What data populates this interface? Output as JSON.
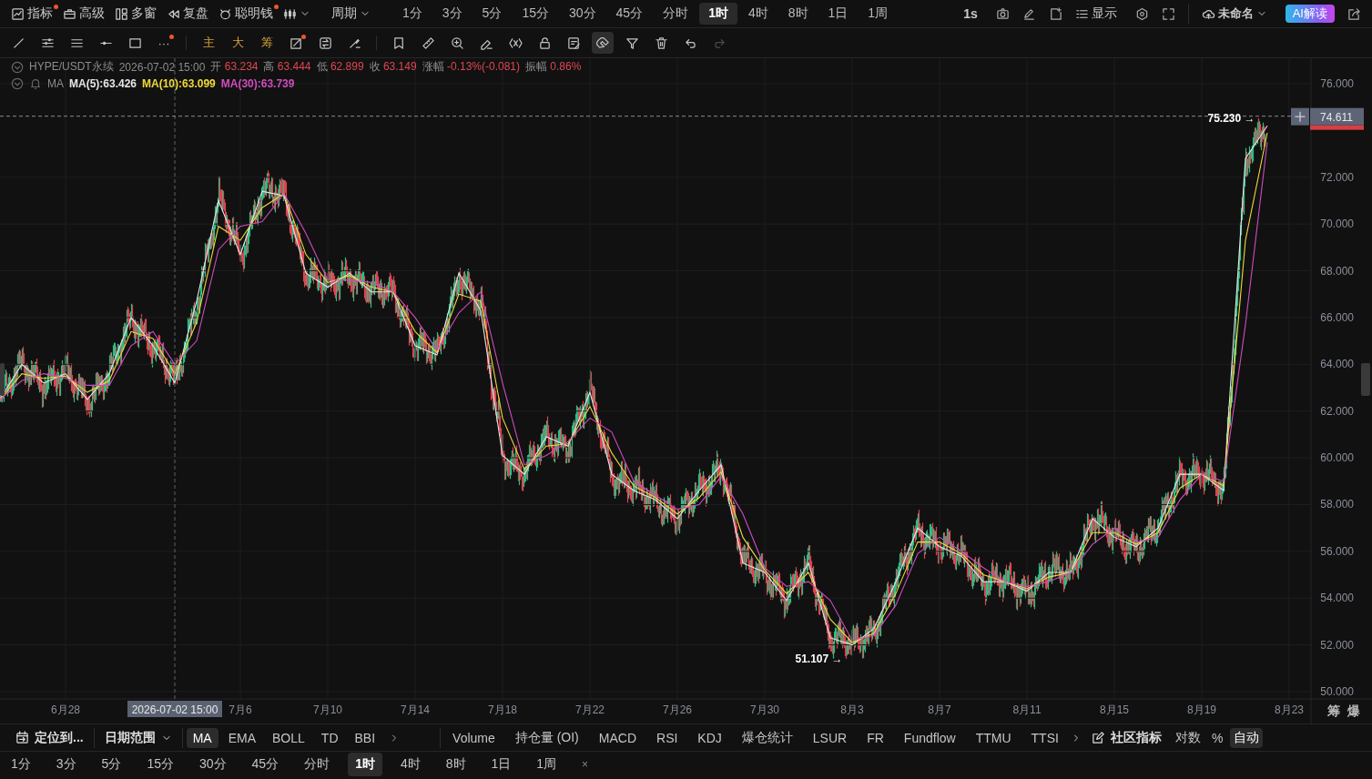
{
  "top_bar": {
    "menus": [
      {
        "label": "指标",
        "dot": true
      },
      {
        "label": "高级",
        "dot": false
      },
      {
        "label": "多窗",
        "dot": false
      },
      {
        "label": "复盘",
        "dot": false
      },
      {
        "label": "聪明钱",
        "dot": true
      }
    ],
    "period_menu": "周期",
    "periods": [
      {
        "label": "1分",
        "selected": false
      },
      {
        "label": "3分",
        "selected": false
      },
      {
        "label": "5分",
        "selected": false
      },
      {
        "label": "15分",
        "selected": false
      },
      {
        "label": "30分",
        "selected": false
      },
      {
        "label": "45分",
        "selected": false
      },
      {
        "label": "分时",
        "selected": false
      },
      {
        "label": "1时",
        "selected": true
      },
      {
        "label": "4时",
        "selected": false
      },
      {
        "label": "8时",
        "selected": false
      },
      {
        "label": "1日",
        "selected": false
      },
      {
        "label": "1周",
        "selected": false
      }
    ],
    "refresh": "1s",
    "display": "显示",
    "layout_name": "未命名",
    "ai_button": "AI解读"
  },
  "draw_toolbar": {
    "groups": [
      {
        "tools": [
          {
            "kind": "icon",
            "dot": false,
            "selected": false,
            "disabled": false
          },
          {
            "kind": "icon",
            "dot": false,
            "selected": false,
            "disabled": false
          },
          {
            "kind": "icon",
            "dot": false,
            "selected": false,
            "disabled": false
          },
          {
            "kind": "icon",
            "dot": false,
            "selected": false,
            "disabled": false
          },
          {
            "kind": "icon",
            "dot": false,
            "selected": false,
            "disabled": false
          },
          {
            "kind": "text",
            "label": "···",
            "dot": true,
            "selected": false,
            "disabled": false
          }
        ]
      },
      {
        "tools": [
          {
            "kind": "text",
            "label": "主",
            "dot": false,
            "selected": false,
            "disabled": false
          },
          {
            "kind": "text",
            "label": "大",
            "dot": false,
            "selected": false,
            "disabled": false
          },
          {
            "kind": "text",
            "label": "筹",
            "dot": false,
            "selected": false,
            "disabled": false
          },
          {
            "kind": "icon",
            "dot": true,
            "selected": false,
            "disabled": false
          },
          {
            "kind": "icon",
            "dot": false,
            "selected": false,
            "disabled": false
          },
          {
            "kind": "icon",
            "dot": false,
            "selected": false,
            "disabled": false
          }
        ]
      },
      {
        "tools": [
          {
            "kind": "icon",
            "dot": false,
            "selected": false,
            "disabled": false
          },
          {
            "kind": "icon",
            "dot": false,
            "selected": false,
            "disabled": false
          },
          {
            "kind": "icon",
            "dot": false,
            "selected": false,
            "disabled": false
          },
          {
            "kind": "icon",
            "dot": false,
            "selected": false,
            "disabled": false
          },
          {
            "kind": "icon",
            "dot": false,
            "selected": false,
            "disabled": false
          },
          {
            "kind": "icon",
            "dot": false,
            "selected": false,
            "disabled": false
          },
          {
            "kind": "icon",
            "dot": false,
            "selected": false,
            "disabled": false
          },
          {
            "kind": "icon",
            "dot": false,
            "selected": true,
            "disabled": false
          },
          {
            "kind": "icon",
            "dot": false,
            "selected": false,
            "disabled": false
          },
          {
            "kind": "icon",
            "dot": false,
            "selected": false,
            "disabled": false
          },
          {
            "kind": "icon",
            "dot": false,
            "selected": false,
            "disabled": false
          },
          {
            "kind": "icon",
            "dot": false,
            "selected": false,
            "disabled": true
          }
        ]
      }
    ]
  },
  "legend": {
    "symbol": "HYPE/USDT永续",
    "time": "2026-07-02 15:00",
    "stats": [
      {
        "label": "开",
        "value": "63.234"
      },
      {
        "label": "高",
        "value": "63.444"
      },
      {
        "label": "低",
        "value": "62.899"
      },
      {
        "label": "收",
        "value": "63.149"
      },
      {
        "label": "涨幅",
        "value": "-0.13%(-0.081)"
      },
      {
        "label": "振幅",
        "value": "0.86%"
      }
    ],
    "ma_label": "MA",
    "ma_readings": [
      ":63.426",
      ":63.099",
      ":63.739"
    ]
  },
  "chart_data": {
    "type": "line",
    "grid": true,
    "categories": [
      null,
      null,
      null,
      "6月28",
      null,
      null,
      null,
      null,
      null,
      null,
      null,
      "7月6",
      null,
      null,
      null,
      "7月10",
      null,
      null,
      null,
      "7月14",
      null,
      null,
      null,
      "7月18",
      null,
      null,
      null,
      "7月22",
      null,
      null,
      null,
      "7月26",
      null,
      null,
      null,
      "7月30",
      null,
      null,
      null,
      "8月3",
      null,
      null,
      null,
      "8月7",
      null,
      null,
      null,
      "8月11",
      null,
      null,
      null,
      "8月15",
      null,
      null,
      null,
      "8月19",
      null,
      null,
      null,
      "8月23"
    ],
    "ylim": [
      50,
      76
    ],
    "yticks": [
      {
        "value": 50,
        "label": "50.000"
      },
      {
        "value": 52,
        "label": "52.000"
      },
      {
        "value": 54,
        "label": "54.000"
      },
      {
        "value": 56,
        "label": "56.000"
      },
      {
        "value": 58,
        "label": "58.000"
      },
      {
        "value": 60,
        "label": "60.000"
      },
      {
        "value": 62,
        "label": "62.000"
      },
      {
        "value": 64,
        "label": "64.000"
      },
      {
        "value": 66,
        "label": "66.000"
      },
      {
        "value": 68,
        "label": "68.000"
      },
      {
        "value": 70,
        "label": "70.000"
      },
      {
        "value": 72,
        "label": "72.000"
      },
      {
        "value": 76,
        "label": "76.000"
      }
    ],
    "series": [
      {
        "name": "MA(5)",
        "color": "#e6e6e6",
        "values": [
          62.5,
          64,
          63.2,
          63.6,
          62.5,
          63.6,
          66,
          64.8,
          63.2,
          66.7,
          71,
          68.7,
          71.4,
          71.2,
          67.9,
          67.3,
          67.9,
          67.1,
          67.1,
          64.8,
          64.4,
          67.9,
          66.3,
          60.1,
          59.3,
          60.9,
          60.5,
          62.8,
          59.3,
          58.6,
          58.2,
          57.4,
          58.6,
          59.7,
          55.5,
          55.1,
          53.9,
          55.5,
          52.3,
          52,
          52.7,
          54.7,
          57,
          56.2,
          55.8,
          54.7,
          54.7,
          54.3,
          55.1,
          55.1,
          57.4,
          56.6,
          56.2,
          57,
          59.3,
          59.3,
          58.6,
          72.8,
          74.2,
          null
        ]
      },
      {
        "name": "MA(10)",
        "color": "#f0d93a",
        "values": [
          62.5,
          63.6,
          63.4,
          63.5,
          62.8,
          63.3,
          65.4,
          65.1,
          63.6,
          65.8,
          69.9,
          69.3,
          70.7,
          71.3,
          68.7,
          67.5,
          67.8,
          67.3,
          67.1,
          65.4,
          64.5,
          67.0,
          66.7,
          61.7,
          59.5,
          60.5,
          60.6,
          62.2,
          60.2,
          58.8,
          58.3,
          57.6,
          58.3,
          59.4,
          56.6,
          55.2,
          54.2,
          55.1,
          53.1,
          52.1,
          52.5,
          54.2,
          56.4,
          56.4,
          55.9,
          55.0,
          54.7,
          54.4,
          54.9,
          55.1,
          56.8,
          56.8,
          56.3,
          56.8,
          58.7,
          59.3,
          58.8,
          69.3,
          73.9,
          null
        ]
      },
      {
        "name": "MA(30)",
        "color": "#d04cbf",
        "values": [
          62.5,
          63.3,
          63.6,
          63.4,
          63.1,
          63.1,
          64.8,
          65.4,
          64.0,
          65.0,
          68.9,
          69.9,
          70.1,
          71.3,
          69.6,
          67.6,
          67.6,
          67.5,
          67.1,
          66.0,
          64.6,
          66.2,
          67.1,
          63.2,
          59.7,
          60.1,
          60.7,
          61.7,
          61.1,
          59.0,
          58.4,
          57.8,
          58.0,
          59.2,
          57.6,
          55.3,
          54.5,
          54.7,
          53.9,
          52.2,
          52.4,
          53.7,
          55.9,
          56.6,
          56.0,
          55.3,
          54.7,
          54.5,
          54.7,
          55.1,
          56.3,
          57.0,
          56.4,
          56.6,
          58.2,
          59.3,
          59.0,
          65.7,
          73.5,
          null
        ]
      }
    ],
    "ref_lines": [
      {
        "axis": "y",
        "value": 74.611,
        "label": "74.611"
      }
    ]
  },
  "chart_overlay": {
    "crosshair_label": "2026-07-02 15:00",
    "high_label": "75.230 →",
    "low_label": "51.107 →",
    "axis_buttons": [
      "筹",
      "爆"
    ]
  },
  "indicator_bar": {
    "locate": "定位到...",
    "date_range": "日期范围",
    "main": [
      {
        "label": "MA",
        "selected": true
      },
      {
        "label": "EMA",
        "selected": false
      },
      {
        "label": "BOLL",
        "selected": false
      },
      {
        "label": "TD",
        "selected": false
      },
      {
        "label": "BBI",
        "selected": false
      }
    ],
    "sub": [
      {
        "label": "Volume"
      },
      {
        "label": "持仓量 (OI)"
      },
      {
        "label": "MACD"
      },
      {
        "label": "RSI"
      },
      {
        "label": "KDJ"
      },
      {
        "label": "爆仓统计"
      },
      {
        "label": "LSUR"
      },
      {
        "label": "FR"
      },
      {
        "label": "Fundflow"
      },
      {
        "label": "TTMU"
      },
      {
        "label": "TTSI"
      }
    ],
    "community": "社区指标",
    "scales": [
      {
        "label": "对数",
        "selected": false
      },
      {
        "label": "%",
        "selected": false
      },
      {
        "label": "自动",
        "selected": true
      }
    ]
  },
  "quick_periods": {
    "items": [
      {
        "label": "1分",
        "selected": false
      },
      {
        "label": "3分",
        "selected": false
      },
      {
        "label": "5分",
        "selected": false
      },
      {
        "label": "15分",
        "selected": false
      },
      {
        "label": "30分",
        "selected": false
      },
      {
        "label": "45分",
        "selected": false
      },
      {
        "label": "分时",
        "selected": false
      },
      {
        "label": "1时",
        "selected": true
      },
      {
        "label": "4时",
        "selected": false
      },
      {
        "label": "8时",
        "selected": false
      },
      {
        "label": "1日",
        "selected": false
      },
      {
        "label": "1周",
        "selected": false
      }
    ],
    "close": "×"
  }
}
